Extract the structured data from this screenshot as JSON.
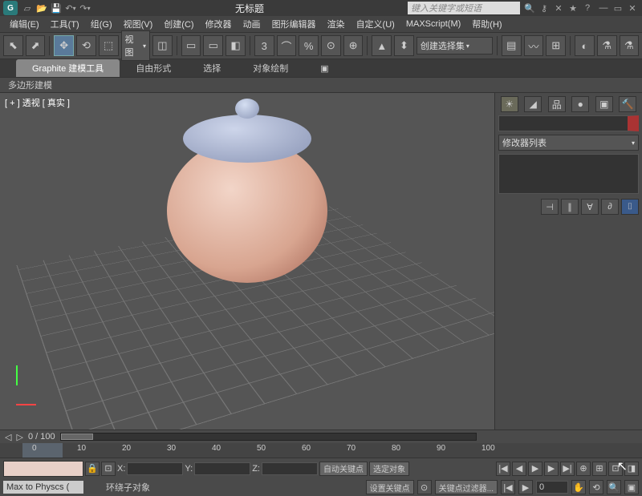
{
  "title": "无标题",
  "search_placeholder": "键入关键字或短语",
  "menus": [
    "编辑(E)",
    "工具(T)",
    "组(G)",
    "视图(V)",
    "创建(C)",
    "修改器",
    "动画",
    "图形编辑器",
    "渲染",
    "自定义(U)",
    "MAXScript(M)",
    "帮助(H)"
  ],
  "toolbar": {
    "view_dropdown": "视图",
    "selection_set": "创建选择集"
  },
  "ribbon": {
    "tabs": [
      "Graphite 建模工具",
      "自由形式",
      "选择",
      "对象绘制"
    ],
    "sub_label": "多边形建模"
  },
  "viewport": {
    "label": "[ + ] 透视 [ 真实 ]"
  },
  "right_panel": {
    "modifier_list": "修改器列表"
  },
  "timeline": {
    "frame_display": "0 / 100",
    "ticks": [
      "0",
      "10",
      "20",
      "30",
      "40",
      "50",
      "60",
      "70",
      "80",
      "90",
      "100"
    ]
  },
  "bottom": {
    "coords": {
      "x_label": "X:",
      "y_label": "Y:",
      "z_label": "Z:"
    },
    "auto_key": "自动关键点",
    "selected_obj": "选定对象",
    "set_key": "设置关键点",
    "key_filter": "关键点过滤器...",
    "spinner_val": "0"
  },
  "status": {
    "script_label": "Max to Physcs (",
    "orbit": "环绕子对象"
  },
  "icons": {
    "sun": "☀",
    "wrench": "🔧",
    "hammer": "🔨",
    "tv": "▣",
    "sphere": "●",
    "pin": "⊣",
    "pause": "∥",
    "show": "∀",
    "stack": "∂",
    "cyl": "⌷",
    "play": "▶",
    "prev": "◀",
    "next": "▶",
    "first": "|◀",
    "last": "▶|",
    "rec": "●",
    "key": "⊙"
  }
}
